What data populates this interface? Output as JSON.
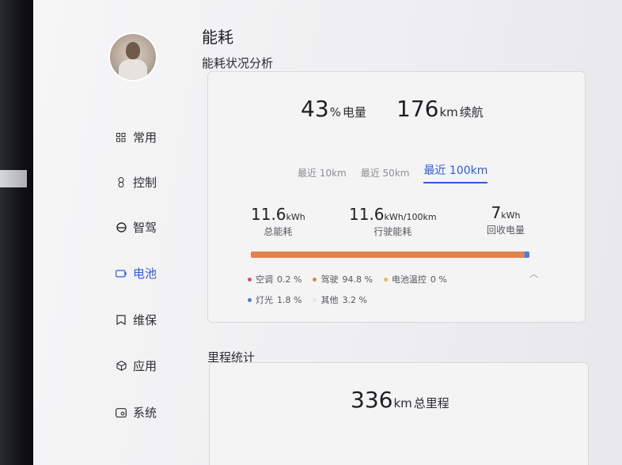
{
  "sidebar": {
    "items": [
      {
        "label": "常用",
        "icon": "grid-icon"
      },
      {
        "label": "控制",
        "icon": "control-icon"
      },
      {
        "label": "智驾",
        "icon": "steering-wheel-icon"
      },
      {
        "label": "电池",
        "icon": "battery-icon",
        "active": true
      },
      {
        "label": "维保",
        "icon": "maintenance-icon"
      },
      {
        "label": "应用",
        "icon": "apps-icon"
      },
      {
        "label": "系统",
        "icon": "system-icon"
      }
    ]
  },
  "page": {
    "title": "能耗",
    "section_title": "能耗状况分析",
    "section2_title": "里程统计"
  },
  "summary": {
    "battery_value": "43",
    "battery_unit": "%",
    "battery_label": "电量",
    "range_value": "176",
    "range_unit": "km",
    "range_label": "续航"
  },
  "tabs": [
    {
      "label": "最近 10km",
      "active": false
    },
    {
      "label": "最近 50km",
      "active": false
    },
    {
      "label": "最近 100km",
      "active": true
    }
  ],
  "stats": [
    {
      "value": "11.6",
      "unit": "kWh",
      "caption": "总能耗"
    },
    {
      "value": "11.6",
      "unit": "kWh/100km",
      "caption": "行驶能耗"
    },
    {
      "value": "7",
      "unit": "kWh",
      "caption": "回收电量"
    }
  ],
  "breakdown": {
    "legend_row1": [
      {
        "label": "空调",
        "value": "0.2 %",
        "color": "#d9515a"
      },
      {
        "label": "驾驶",
        "value": "94.8 %",
        "color": "#e2834f"
      },
      {
        "label": "电池温控",
        "value": "0 %",
        "color": "#e3b85a"
      }
    ],
    "legend_row2": [
      {
        "label": "灯光",
        "value": "1.8 %",
        "color": "#4a7fd3"
      },
      {
        "label": "其他",
        "value": "3.2 %",
        "color": "#e9e9ea"
      }
    ],
    "bar_fractions": {
      "空调": 0.002,
      "驾驶": 0.948,
      "电池温控": 0,
      "灯光": 0.018,
      "其他": 0.032
    }
  },
  "mileage": {
    "total_value": "336",
    "total_unit": "km",
    "total_label": "总里程"
  }
}
